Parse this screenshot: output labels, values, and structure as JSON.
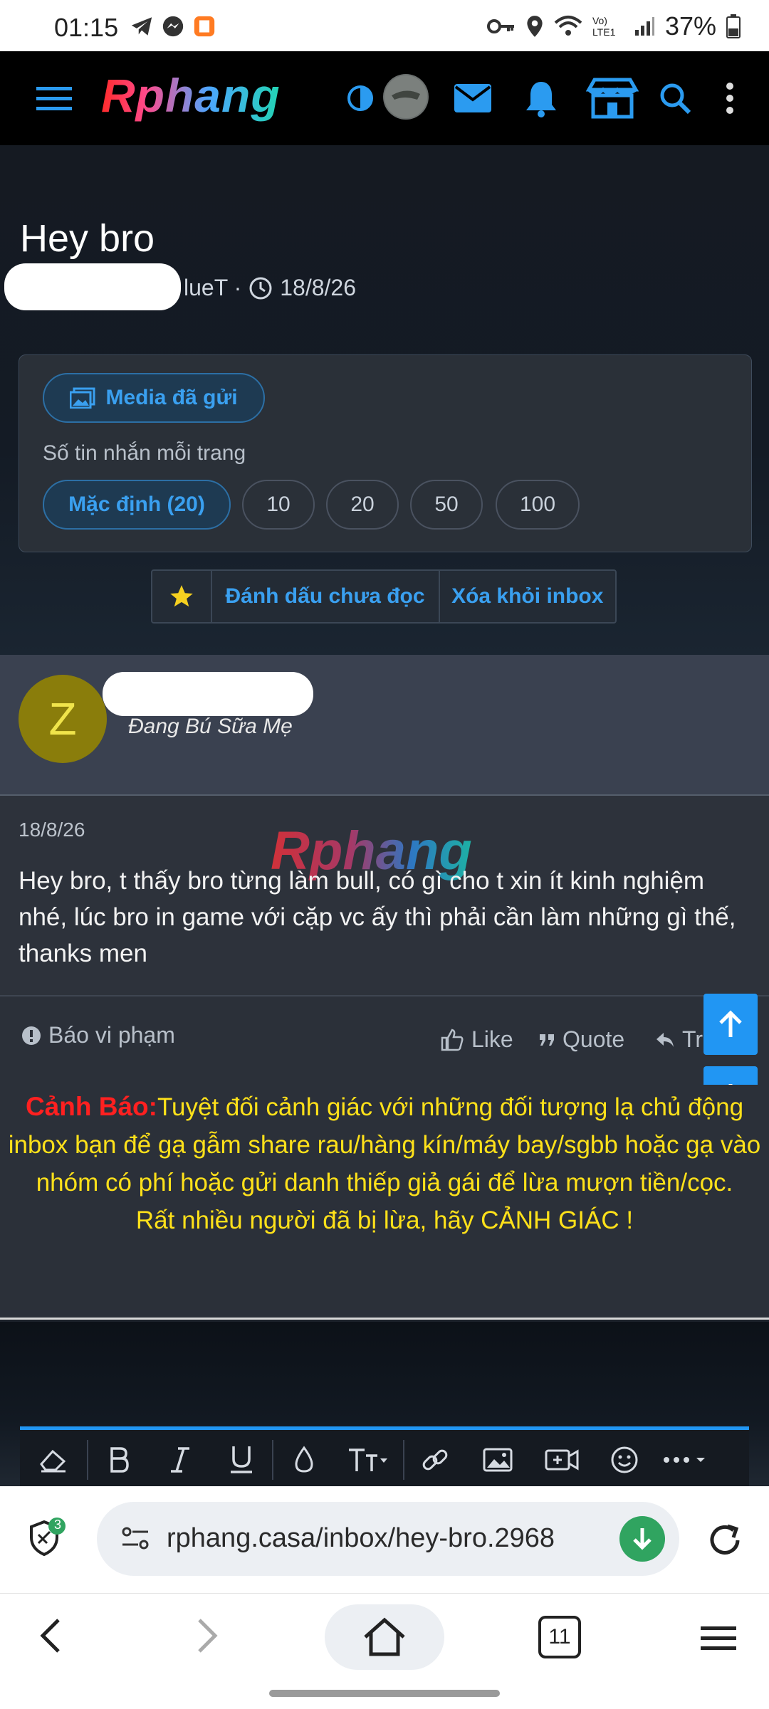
{
  "status_bar": {
    "time": "01:15",
    "battery": "37%",
    "network": "Vo) LTE1"
  },
  "header": {
    "logo": "Rphang"
  },
  "thread": {
    "title": "Hey bro",
    "author_suffix": "lueT ·",
    "date": "18/8/26"
  },
  "options": {
    "media_button": "Media đã gửi",
    "per_page_label": "Số tin nhắn mỗi trang",
    "per_page_options": [
      "Mặc định (20)",
      "10",
      "20",
      "50",
      "100"
    ]
  },
  "actions": {
    "mark_unread": "Đánh dấu chưa đọc",
    "remove_inbox": "Xóa khỏi inbox"
  },
  "message": {
    "avatar_letter": "Z",
    "user_title": "Đang Bú Sữa Mẹ",
    "date": "18/8/26",
    "watermark": "Rphang",
    "text": "Hey bro, t thấy bro từng làm bull, có gì cho t xin ít kinh nghiệm nhé, lúc bro in game với cặp vc ấy thì phải cần làm những gì thế, thanks men",
    "report": "Báo vi phạm",
    "like": "Like",
    "quote": "Quote",
    "reply_partial": "Tr"
  },
  "warning": {
    "label": "Cảnh Báo:",
    "text": "Tuyệt đối cảnh giác với những đối tượng lạ chủ động inbox bạn để gạ gẫm share rau/hàng kín/máy bay/sgbb hoặc gạ vào nhóm có phí hoặc gửi danh thiếp giả gái để lừa mượn tiền/cọc.",
    "text2": "Rất nhiều người đã bị lừa, hãy CẢNH GIÁC !"
  },
  "browser": {
    "url": "rphang.casa/inbox/hey-bro.2968",
    "shield_badge": "3",
    "tab_count": "11"
  }
}
